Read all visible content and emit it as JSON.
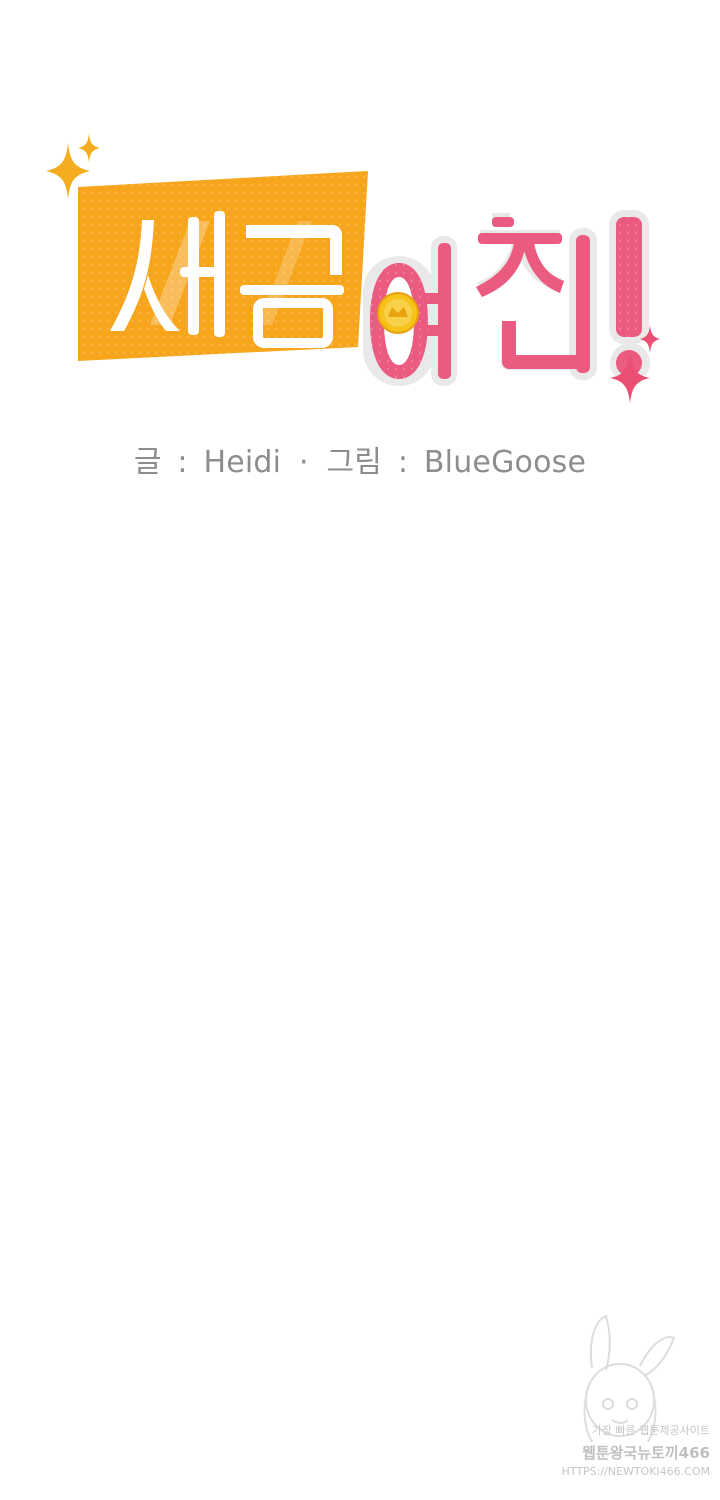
{
  "title": {
    "part1": "세금",
    "part2": "여친",
    "exclamation": "!"
  },
  "credits": {
    "writer_label": "글",
    "writer": "Heidi",
    "separator": "·",
    "artist_label": "그림",
    "artist": "BlueGoose",
    "colon": ":"
  },
  "watermark": {
    "line1": "가장 빠른 웹툰제공사이트",
    "line2": "웹툰왕국뉴토끼466",
    "line3": "HTTPS://NEWTOKI466.COM"
  },
  "colors": {
    "orange_box": "#f7a51c",
    "pink_title": "#eb5a7f",
    "gold_sparkle": "#f3ad1e",
    "pink_sparkle": "#ea4f73",
    "credits_text": "#8d8d8d",
    "coin": "#f7c21a"
  },
  "icons": [
    "sparkle-icon",
    "coin-icon",
    "bunny-mascot-icon"
  ]
}
